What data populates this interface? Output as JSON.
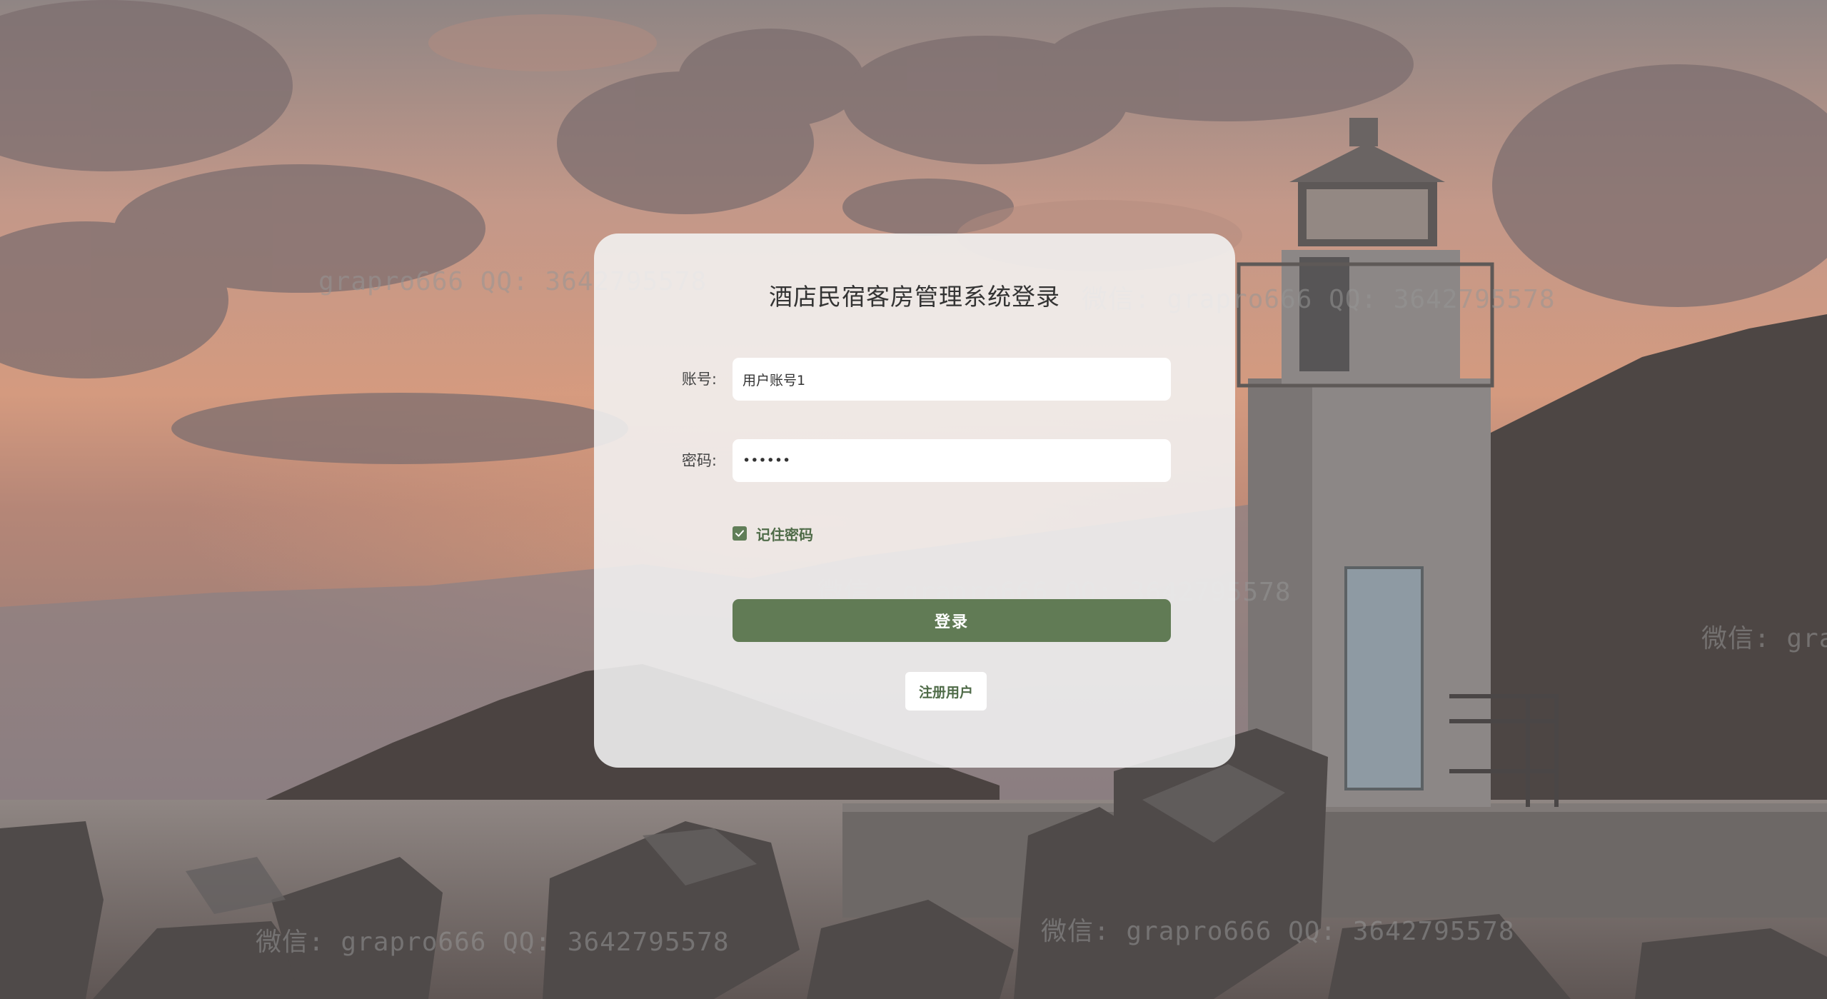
{
  "login": {
    "title": "酒店民宿客房管理系统登录",
    "account_label": "账号:",
    "account_value": "用户账号1",
    "password_label": "密码:",
    "password_value": "123456",
    "remember_label": "记住密码",
    "remember_checked": true,
    "login_button": "登录",
    "register_button": "注册用户"
  },
  "watermark": {
    "full": "微信: grapro666 QQ: 3642795578",
    "partial_a": "grapro666 QQ: 3642795578",
    "partial_b": "微信: grapro666 QQ: 3642795578",
    "partial_c": "微信: gra"
  },
  "colors": {
    "accent": "#617b55",
    "checkbox": "#607e58",
    "card_bg": "#f2f2f2"
  },
  "icons": {
    "checkbox": "check-icon"
  }
}
